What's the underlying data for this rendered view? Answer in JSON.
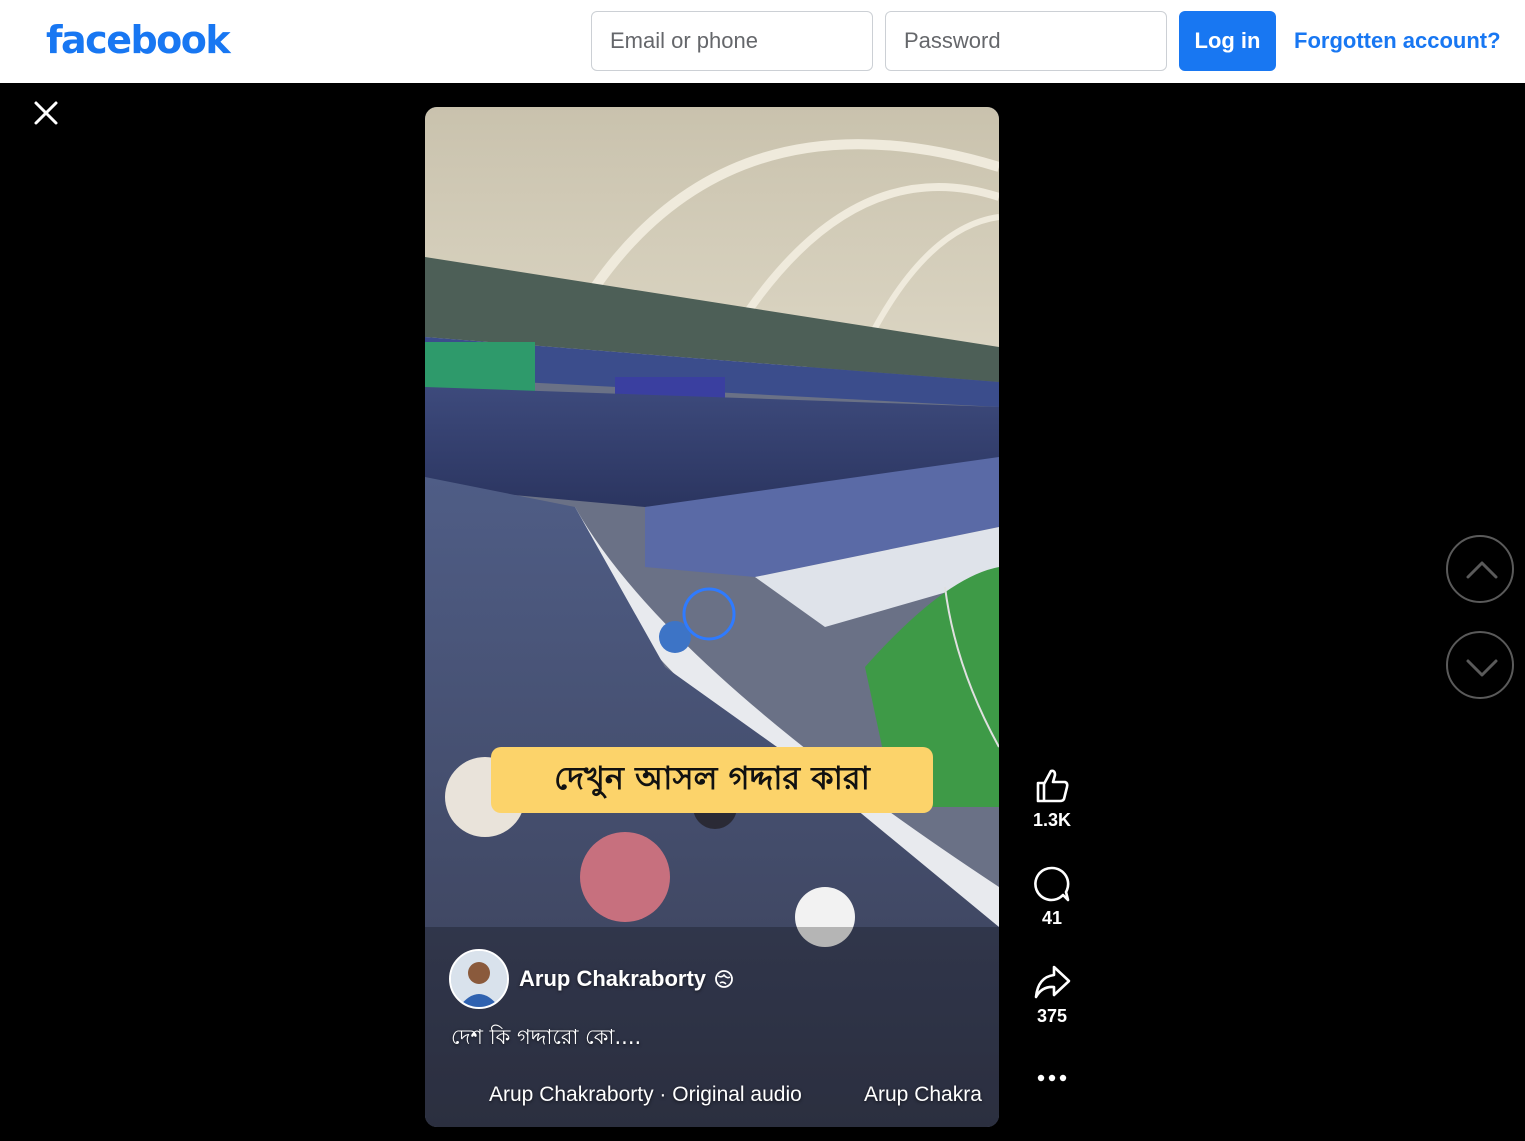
{
  "header": {
    "logo": "facebook",
    "email_placeholder": "Email or phone",
    "password_placeholder": "Password",
    "login_label": "Log in",
    "forgot_label": "Forgotten account?"
  },
  "viewer": {
    "close_icon": "close-icon",
    "video": {
      "overlay_text": "দেখুন আসল গদ্দার কারা",
      "author": "Arup Chakraborty",
      "privacy_icon": "globe-icon",
      "post_text": "দেশ কি গদ্দারো কো....",
      "audio_text": "Arup Chakraborty · Original audio",
      "audio_text_repeat": "Arup Chakra"
    },
    "actions": {
      "like": {
        "icon": "thumbs-up-icon",
        "count": "1.3K"
      },
      "comment": {
        "icon": "comment-icon",
        "count": "41"
      },
      "share": {
        "icon": "share-icon",
        "count": "375"
      },
      "more": {
        "icon": "more-icon"
      }
    },
    "nav": {
      "prev_icon": "chevron-up-icon",
      "next_icon": "chevron-down-icon"
    }
  },
  "colors": {
    "brand": "#1877f2",
    "overlay_bg": "#000000",
    "caption_bg": "#fcd36a"
  }
}
